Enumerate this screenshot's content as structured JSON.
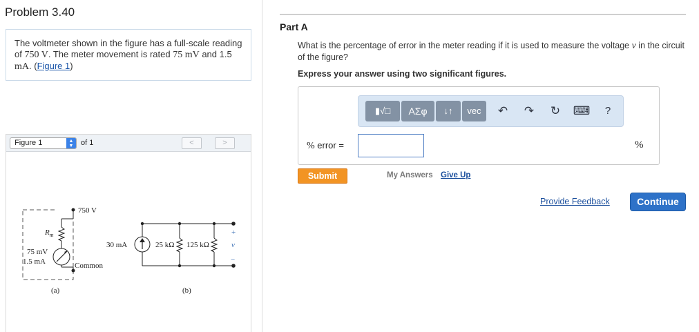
{
  "problem": {
    "title": "Problem 3.40",
    "text_1": "The voltmeter shown in the figure has a full-scale reading of ",
    "fullscale_value": "750 V",
    "text_2": ". The meter movement is rated ",
    "rated_mv": "75 mV",
    "text_3": " and 1.5 ",
    "rated_ma_unit": "mA",
    "text_4": ". (",
    "figure_link": "Figure 1",
    "text_5": ")"
  },
  "figure": {
    "selector_label": "Figure 1",
    "of_label": "of 1",
    "prev_glyph": "<",
    "next_glyph": ">",
    "labels": {
      "v750": "750 V",
      "rm": "R",
      "rm_sub": "m",
      "mv75": "75 mV",
      "ma15": "1.5 mA",
      "common": "Common",
      "a": "(a)",
      "ma30": "30 mA",
      "r25": "25 kΩ",
      "r125": "125 kΩ",
      "plus": "+",
      "v": "v",
      "minus": "−",
      "b": "(b)"
    }
  },
  "part": {
    "title": "Part A",
    "question_1": "What is the percentage of error in the meter reading if it is used to measure the voltage ",
    "question_var": "v",
    "question_2": " in the circuit of the figure?",
    "instruction": "Express your answer using two significant figures."
  },
  "toolbar": {
    "templates_label": "▮√□",
    "greek_label": "ΑΣφ",
    "arrows_label": "↓↑",
    "vec_label": "vec",
    "undo_glyph": "↶",
    "redo_glyph": "↷",
    "reset_glyph": "↻",
    "keyboard_glyph": "⌨",
    "help_glyph": "?"
  },
  "answer": {
    "label_symbol": "%",
    "label_text": " error =",
    "value": "",
    "unit": "%"
  },
  "actions": {
    "submit": "Submit",
    "my_answers": "My Answers",
    "give_up": "Give Up",
    "feedback": "Provide Feedback",
    "continue": "Continue"
  }
}
